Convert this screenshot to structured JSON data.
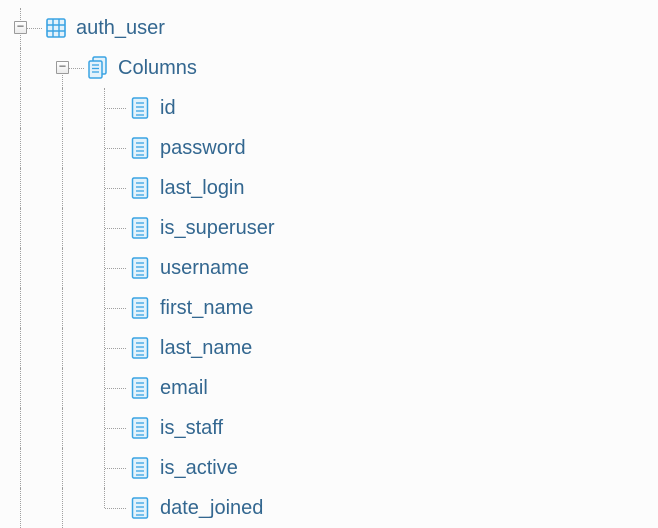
{
  "tree": {
    "table": {
      "label": "auth_user",
      "columns_label": "Columns",
      "columns": [
        "id",
        "password",
        "last_login",
        "is_superuser",
        "username",
        "first_name",
        "last_name",
        "email",
        "is_staff",
        "is_active",
        "date_joined"
      ]
    }
  },
  "colors": {
    "text": "#336790",
    "line": "#a0a0a0",
    "icon_stroke": "#3aa3e3",
    "icon_fill": "#e3f2fb"
  }
}
